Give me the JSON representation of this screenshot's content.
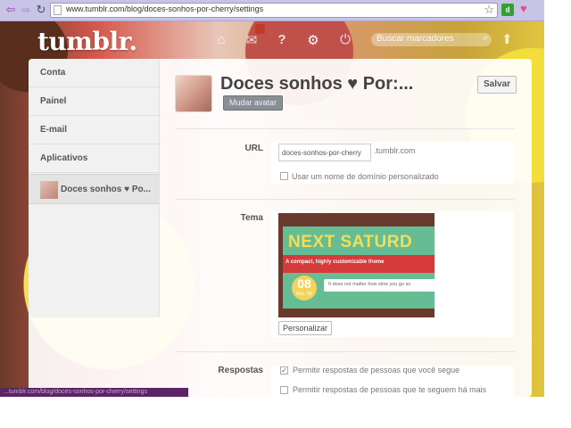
{
  "browser": {
    "url": "www.tumblr.com/blog/doces-sonhos-por-cherry/settings",
    "back_glyph": "⇦",
    "forward_glyph": "⇨",
    "reload_glyph": "↻",
    "star_glyph": "☆",
    "heart_glyph": "♥",
    "signal_glyph": "ıl"
  },
  "header": {
    "logo": "tumblr.",
    "search_placeholder": "Buscar marcadores",
    "icons": {
      "home": "⌂",
      "mail": "✉",
      "help": "?",
      "gear": "⚙",
      "power": "⏻",
      "search": "⌕",
      "compose": "⬆"
    }
  },
  "sidebar": {
    "items": [
      {
        "label": "Conta"
      },
      {
        "label": "Painel"
      },
      {
        "label": "E-mail"
      },
      {
        "label": "Aplicativos"
      },
      {
        "label": "Doces sonhos ♥ Po..."
      }
    ]
  },
  "blog": {
    "title": "Doces sonhos ♥ Por:...",
    "change_avatar": "Mudar avatar",
    "save": "Salvar"
  },
  "url_section": {
    "label": "URL",
    "value": "doces-sonhos-por-cherry",
    "suffix": ".tumblr.com",
    "custom_domain": "Usar um nome de domínio personalizado",
    "custom_domain_checked": false
  },
  "theme_section": {
    "label": "Tema",
    "preview_headline": "NEXT SATURD",
    "preview_banner": "A compact, highly customizable theme",
    "preview_day": "08",
    "preview_month": "Nov. '08",
    "preview_note": "It does not matter how slow you go so",
    "customize": "Personalizar"
  },
  "replies_section": {
    "label": "Respostas",
    "options": [
      {
        "label": "Permitir respostas de pessoas que você segue",
        "checked": true
      },
      {
        "label": "Permitir respostas de pessoas que te seguem há mais",
        "checked": false
      }
    ]
  },
  "status_bar": {
    "text": "...tumblr.com/blog/doces-sonhos-por-cherry/settings"
  },
  "colors": {
    "browser_frame": "#c8c4e6",
    "status_bar": "#5b2466",
    "inbox_badge": "#c0392b",
    "theme_red": "#d63a3a",
    "theme_green": "#66bd94",
    "theme_yellow": "#f5dd55"
  }
}
